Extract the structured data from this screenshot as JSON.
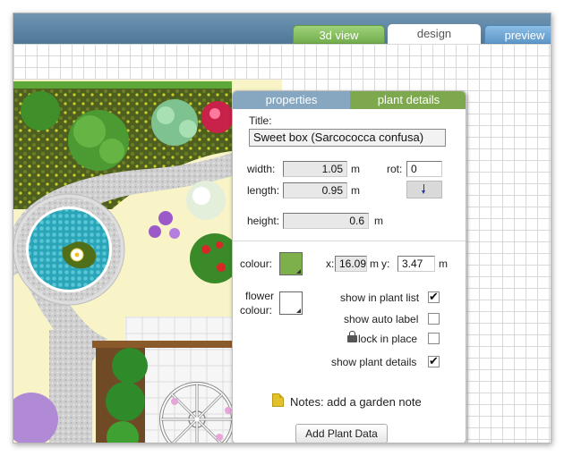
{
  "tabs": {
    "view3d": "3d view",
    "design": "design",
    "preview": "preview"
  },
  "dialog": {
    "tab_properties": "properties",
    "tab_plant_details": "plant details",
    "title_label": "Title:",
    "title_value": "Sweet box (Sarcococca confusa)",
    "width_label": "width:",
    "width_value": "1.05",
    "length_label": "length:",
    "length_value": "0.95",
    "height_label": "height:",
    "height_value": "0.6",
    "unit_m": "m",
    "rot_label": "rot:",
    "rot_value": "0",
    "colour_label": "colour:",
    "colour_value": "#7db04a",
    "flower_colour_label_1": "flower",
    "flower_colour_label_2": "colour:",
    "flower_colour_value": "#ffffff",
    "x_label": "x:",
    "x_value": "16.09",
    "y_label": "y:",
    "y_value": "3.47",
    "show_in_plant_list": {
      "label": "show in plant list",
      "checked": true
    },
    "show_auto_label": {
      "label": "show auto label",
      "checked": false
    },
    "lock_in_place": {
      "label": "lock in place",
      "checked": false
    },
    "show_plant_details": {
      "label": "show plant details",
      "checked": true
    },
    "check_mark": "✔",
    "notes_text": "Notes: add a garden note",
    "add_plant_data": "Add Plant Data"
  },
  "colors": {
    "header": "#5a82a2",
    "tab_3d": "#7db04a",
    "tab_preview": "#6aa4d4",
    "plant_tab": "#7da84d",
    "properties_tab": "#86a7bf"
  },
  "icons": [
    "lock-icon",
    "note-icon",
    "rotation-dial-icon",
    "color-dropdown-icon"
  ]
}
